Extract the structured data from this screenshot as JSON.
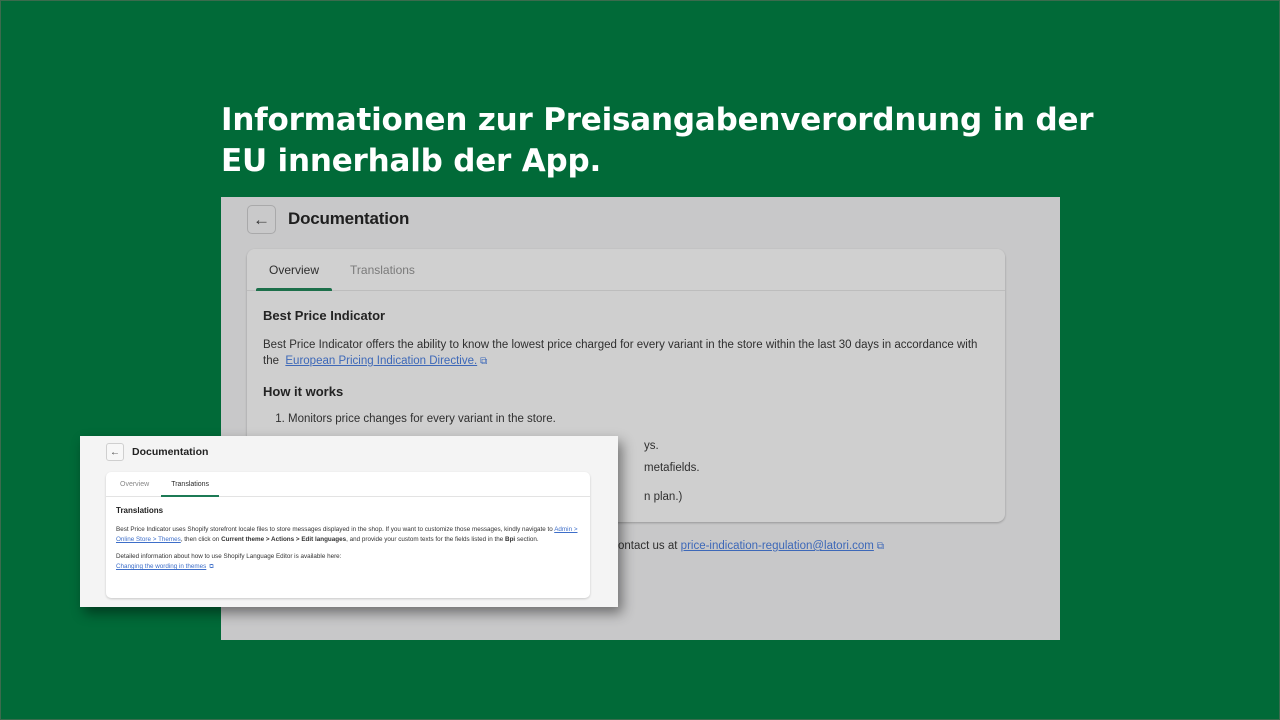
{
  "colors": {
    "background": "#016a38",
    "headline": "#ffffff",
    "accent_tab": "#1c6f4a",
    "link": "#3d68b8"
  },
  "headline": {
    "line1": "Informationen zur Preisangabenverordnung in der",
    "line2": "EU innerhalb der App."
  },
  "main_screenshot": {
    "back_icon": "arrow-left-icon",
    "back_glyph": "←",
    "title": "Documentation",
    "tabs": [
      {
        "label": "Overview",
        "active": true
      },
      {
        "label": "Translations",
        "active": false
      }
    ],
    "section_title": "Best Price Indicator",
    "intro_text": "Best Price Indicator offers the ability to know the lowest price charged for every variant in the store within the last 30 days in accordance with the",
    "intro_link": "European Pricing Indication Directive.",
    "ext_icon_glyph": "⧉",
    "how_title": "How it works",
    "steps": [
      "Monitors price changes for every variant in the store.",
      "ys.",
      "metafields.",
      "n plan.)"
    ],
    "contact_prefix": "ontact us at",
    "contact_email": "price-indication-regulation@latori.com"
  },
  "overlay_screenshot": {
    "back_glyph": "←",
    "title": "Documentation",
    "tabs": [
      {
        "label": "Overview",
        "active": false
      },
      {
        "label": "Translations",
        "active": true
      }
    ],
    "section_title": "Translations",
    "para1_part1": "Best Price Indicator uses Shopify storefront locale files to store messages displayed in the shop. If you want to customize those messages, kindly navigate to",
    "para1_link": "Admin > Online Store > Themes",
    "para1_part2": ", then click on",
    "para1_bold1": "Current theme > Actions > Edit languages",
    "para1_part3": ", and provide your custom texts for the fields listed in the",
    "para1_bold2": "Bpi",
    "para1_part4": "section.",
    "para2_text": "Detailed information about how to use Shopify Language Editor is available here:",
    "para2_link": "Changing the wording in themes",
    "ext_icon_glyph": "⧉"
  }
}
